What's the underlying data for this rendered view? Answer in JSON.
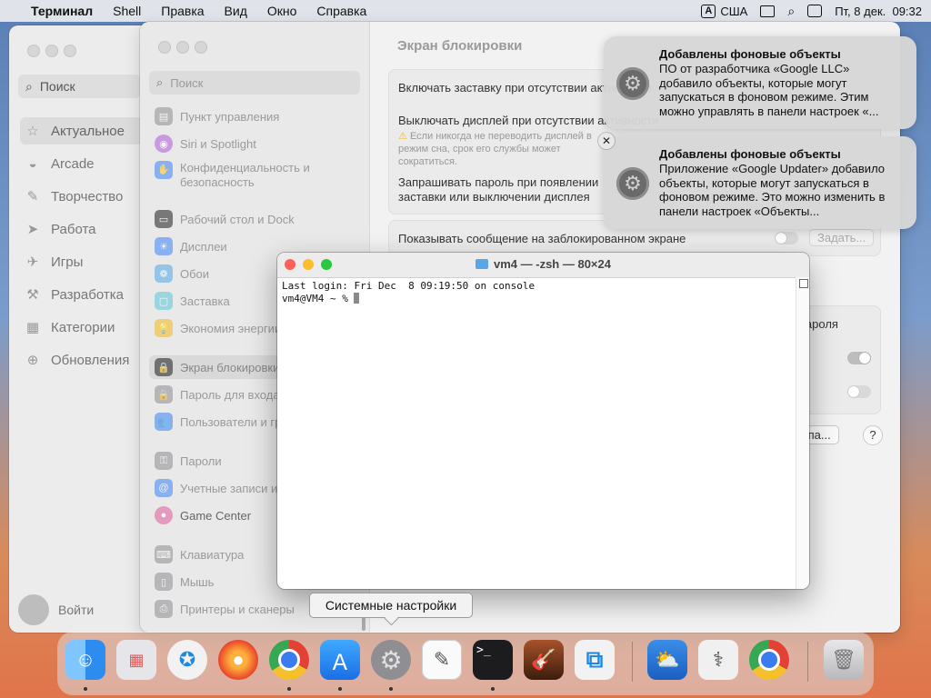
{
  "menubar": {
    "apple": "",
    "app_name": "Терминал",
    "items": [
      "Shell",
      "Правка",
      "Вид",
      "Окно",
      "Справка"
    ],
    "input_badge": "A",
    "input_source": "США",
    "datetime": "Пт, 8 дек.  09:32"
  },
  "appstore": {
    "search_label": "Поиск",
    "nav": [
      "Актуальное",
      "Arcade",
      "Творчество",
      "Работа",
      "Игры",
      "Разработка",
      "Категории",
      "Обновления"
    ],
    "user_label": "Войти"
  },
  "settings": {
    "search_placeholder": "Поиск",
    "sidebar": [
      "Пункт управления",
      "Siri и Spotlight",
      "Конфиденциальность и безопасность",
      "Рабочий стол и Dock",
      "Дисплеи",
      "Обои",
      "Заставка",
      "Экономия энергии",
      "Экран блокировки",
      "Пароль для входа",
      "Пользователи и группы",
      "Пароли",
      "Учетные записи интернета",
      "Game Center",
      "Клавиатура",
      "Мышь",
      "Принтеры и сканеры"
    ],
    "pane_title": "Экран блокировки",
    "rows": {
      "screensaver": "Включать заставку при отсутствии активности",
      "display_off": "Выключать дисплей при отсутствии активности",
      "display_warning": "Если никогда не переводить дисплей в режим сна, срок его службы может сократиться.",
      "require_password": "Запрашивать пароль при появлении заставки или выключении дисплея",
      "show_message": "Показывать сообщение на заблокированном экране",
      "set_button": "Задать...",
      "login_window_header": "и пароля",
      "access_button": "тупа...",
      "help": "?"
    }
  },
  "terminal": {
    "title": "vm4 — -zsh — 80×24",
    "line1": "Last login: Fri Dec  8 09:19:50 on console",
    "prompt": "vm4@VM4 ~ % "
  },
  "notifications": [
    {
      "title": "Добавлены фоновые объекты",
      "body": "ПО от разработчика «Google LLC» добавило объекты, которые могут запускаться в фоновом режиме. Этим можно управлять в панели настроек «..."
    },
    {
      "title": "Добавлены фоновые объекты",
      "body": "Приложение «Google Updater» добавило объекты, которые могут запускаться в фоновом режиме. Это можно изменить в панели настроек «Объекты..."
    }
  ],
  "tooltip": "Системные настройки",
  "colors": {
    "close": "#fe5f57",
    "minimize": "#febc2e",
    "zoom": "#28c840"
  }
}
